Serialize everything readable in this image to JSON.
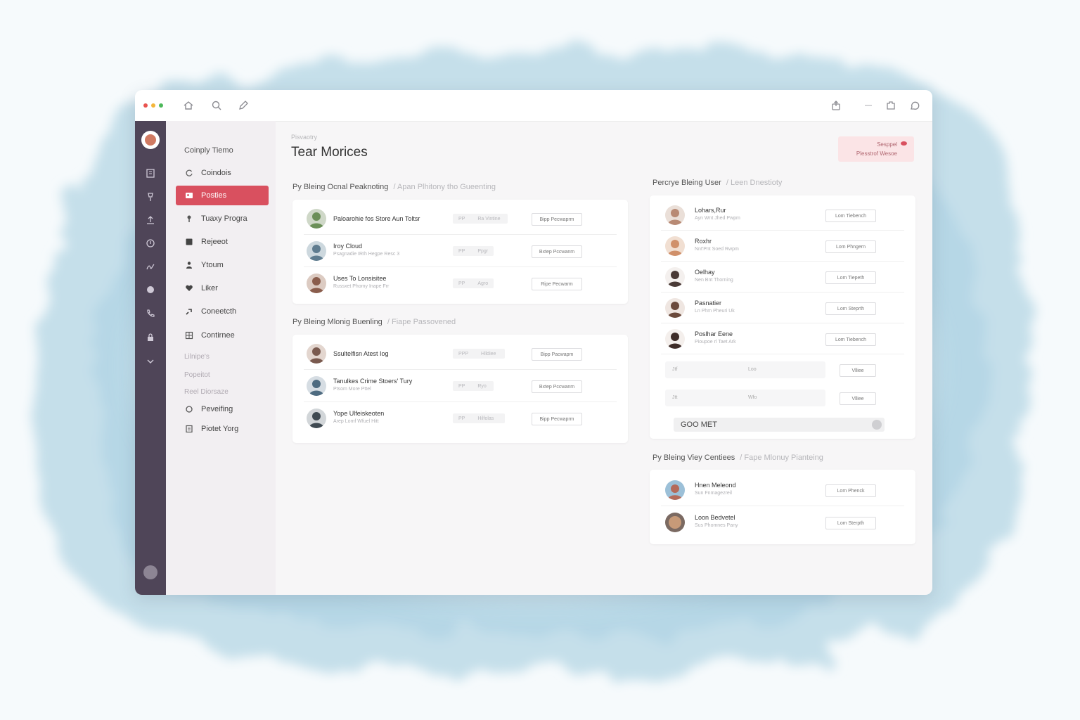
{
  "window": {
    "toolbar_icons": [
      "home-icon",
      "search-icon",
      "pen-icon",
      "share-icon",
      "minimize-icon",
      "extension-icon",
      "chat-icon"
    ],
    "traffic_lights": [
      "#e9534f",
      "#f4b63b",
      "#4cb85a"
    ]
  },
  "rail": {
    "icons": [
      "building-icon",
      "pin-icon",
      "upload-icon",
      "shield-icon",
      "signature-icon",
      "globe-icon",
      "phone-icon",
      "lock-icon",
      "chevron-down-icon"
    ]
  },
  "nav": {
    "title": "Coinply Tiemo",
    "items": [
      {
        "label": "Coindois",
        "icon": "refresh-icon"
      },
      {
        "label": "Posties",
        "icon": "users-icon",
        "active": true
      },
      {
        "label": "Tuaxy Progra",
        "icon": "bulb-icon"
      },
      {
        "label": "Rejeeot",
        "icon": "square-icon"
      },
      {
        "label": "Ytoum",
        "icon": "person-icon"
      },
      {
        "label": "Liker",
        "icon": "heart-icon"
      },
      {
        "label": "Coneetcth",
        "icon": "link-icon"
      },
      {
        "label": "Contirnee",
        "icon": "grid-icon"
      }
    ],
    "sections": [
      "Lilnipe's",
      "Popeitot",
      "Reel Diorsaze"
    ],
    "extra_items": [
      {
        "label": "Peveifing",
        "icon": "circle-icon"
      },
      {
        "label": "Piotet Yorg",
        "icon": "doc-icon"
      }
    ]
  },
  "header": {
    "breadcrumb": "Pisvaotry",
    "title": "Tear Morices",
    "notice_line1": "Sesppel",
    "notice_line2": "Plesstrof Wesoe"
  },
  "left": {
    "section1": {
      "title": "Py Bleing Ocnal Peaknoting",
      "subtitle": "Apan Plhitony tho Gueenting",
      "rows": [
        {
          "name": "Paloarohie fos Store Aun Toltsr",
          "sub": "",
          "pill_a": "PP",
          "pill_b": "Ra Vintine",
          "action": "Bipp Pecwaprm",
          "avatar_color": "#6b8f58"
        },
        {
          "name": "Iroy Cloud",
          "sub": "Psagnadie IRIh Hegpe Resc 3",
          "pill_a": "PP",
          "pill_b": "Ppgr",
          "action": "Bxtep Pccwanm",
          "avatar_color": "#5f7c8f"
        },
        {
          "name": "Uses To Lonsisitee",
          "sub": "Russxet Phomy Inape Frr",
          "pill_a": "PP",
          "pill_b": "Agro",
          "action": "Ripe Pecwarm",
          "avatar_color": "#8a5d4c"
        }
      ]
    },
    "section2": {
      "title": "Py Bleing Mlonig Buenling",
      "subtitle": "Fiape Passovened",
      "rows": [
        {
          "name": "Ssultelfisn Atest Iog",
          "sub": "",
          "pill_a": "PPP",
          "pill_b": "Hlldiee",
          "action": "Bipp Pacwapm",
          "avatar_color": "#7a5a4f"
        },
        {
          "name": "Tanulkes Crime Stoers' Tury",
          "sub": "Ptsom More Pttel",
          "pill_a": "PP",
          "pill_b": "Ryo",
          "action": "Bxtep Pccwanm",
          "avatar_color": "#4e6b80"
        },
        {
          "name": "Yope Ulfeiskeoten",
          "sub": "Arep Lomf Wfuel Hitt",
          "pill_a": "PP",
          "pill_b": "Hilfolas",
          "action": "Bipp Pecwaprm",
          "avatar_color": "#3f4a52"
        }
      ]
    }
  },
  "right": {
    "section1": {
      "title": "Percrye Bleing User",
      "subtitle": "Leen Dnestioty",
      "rows": [
        {
          "name": "Lohars,Rur",
          "sub": "Ayn Wnt Jhed Pwpm",
          "action": "Lom Tiebench",
          "avatar_color": "#b88a74"
        },
        {
          "name": "Roxhr",
          "sub": "Nnt'Pnt Soed Rwpm",
          "action": "Lom Phngern",
          "avatar_color": "#d0906a"
        },
        {
          "name": "Oelhay",
          "sub": "Nen Bnt Thorning",
          "action": "Lom Tiepeth",
          "avatar_color": "#4a3a36"
        },
        {
          "name": "Pasnatier",
          "sub": "Ln Phm Pheuri Uk",
          "action": "Lom Steprth",
          "avatar_color": "#6b4a3c"
        },
        {
          "name": "Poslhar Eene",
          "sub": "Pioupoe rl Taet Ark",
          "action": "Lom Tiebench",
          "avatar_color": "#3e2c28"
        }
      ],
      "empty_rows": [
        {
          "a": "Jtf",
          "b": "Loo",
          "action": "Vlliee"
        },
        {
          "a": "Jtt",
          "b": "Wfo",
          "action": "Vlliee"
        }
      ],
      "search_value": "GOO MET"
    },
    "section2": {
      "title": "Py Bleing Viey Centiees",
      "subtitle": "Fape Mlonuy Pianteing",
      "rows": [
        {
          "name": "Hnen Meleond",
          "sub": "Sun Fnmagezreil",
          "action": "Lom Phenck",
          "avatar_color": "#b46a5a"
        },
        {
          "name": "Loon Bedvetel",
          "sub": "Sus Phomnes Pany",
          "action": "Lom Sterpth",
          "avatar_color": "#c79a78"
        }
      ]
    }
  }
}
